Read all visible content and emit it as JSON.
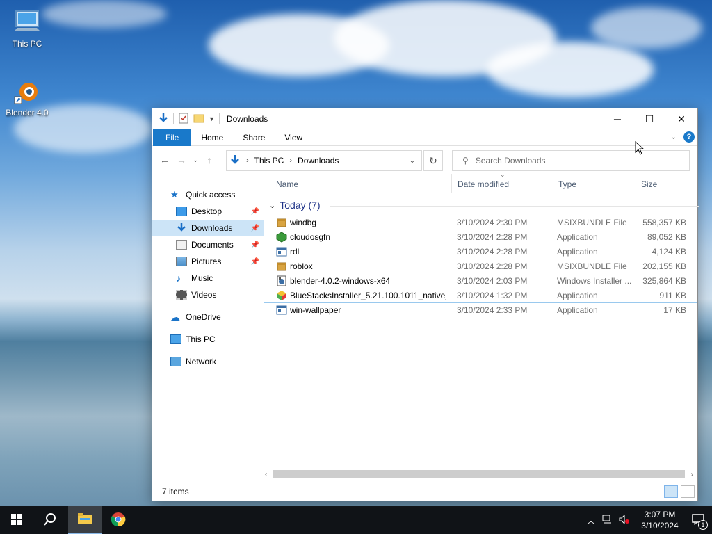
{
  "desktop": {
    "icons": [
      {
        "label": "This PC"
      },
      {
        "label": "Blender 4.0"
      }
    ]
  },
  "window": {
    "title": "Downloads",
    "ribbon_tabs": [
      "File",
      "Home",
      "Share",
      "View"
    ],
    "address": {
      "crumbs": [
        "This PC",
        "Downloads"
      ]
    },
    "search": {
      "placeholder": "Search Downloads"
    },
    "sidebar": {
      "items": [
        {
          "label": "Quick access",
          "icon": "star-icon"
        },
        {
          "label": "Desktop",
          "icon": "desktop-icon",
          "pinned": true
        },
        {
          "label": "Downloads",
          "icon": "download-icon",
          "pinned": true,
          "selected": true
        },
        {
          "label": "Documents",
          "icon": "documents-icon",
          "pinned": true
        },
        {
          "label": "Pictures",
          "icon": "pictures-icon",
          "pinned": true
        },
        {
          "label": "Music",
          "icon": "music-icon"
        },
        {
          "label": "Videos",
          "icon": "videos-icon"
        },
        {
          "label": "OneDrive",
          "icon": "cloud-icon"
        },
        {
          "label": "This PC",
          "icon": "computer-icon"
        },
        {
          "label": "Network",
          "icon": "network-icon"
        }
      ]
    },
    "columns": {
      "name": "Name",
      "date": "Date modified",
      "type": "Type",
      "size": "Size"
    },
    "group": {
      "label": "Today (7)"
    },
    "files": [
      {
        "name": "windbg",
        "date": "3/10/2024 2:30 PM",
        "type": "MSIXBUNDLE File",
        "size": "558,357 KB",
        "icon": "package-icon"
      },
      {
        "name": "cloudosgfn",
        "date": "3/10/2024 2:28 PM",
        "type": "Application",
        "size": "89,052 KB",
        "icon": "app-green-icon"
      },
      {
        "name": "rdl",
        "date": "3/10/2024 2:28 PM",
        "type": "Application",
        "size": "4,124 KB",
        "icon": "app-window-icon"
      },
      {
        "name": "roblox",
        "date": "3/10/2024 2:28 PM",
        "type": "MSIXBUNDLE File",
        "size": "202,155 KB",
        "icon": "package-icon"
      },
      {
        "name": "blender-4.0.2-windows-x64",
        "date": "3/10/2024 2:03 PM",
        "type": "Windows Installer ...",
        "size": "325,864 KB",
        "icon": "installer-icon"
      },
      {
        "name": "BlueStacksInstaller_5.21.100.1011_native_...",
        "date": "3/10/2024 1:32 PM",
        "type": "Application",
        "size": "911 KB",
        "icon": "bluestacks-icon"
      },
      {
        "name": "win-wallpaper",
        "date": "3/10/2024 2:33 PM",
        "type": "Application",
        "size": "17 KB",
        "icon": "app-window-icon"
      }
    ],
    "status": {
      "count": "7 items"
    }
  },
  "taskbar": {
    "time": "3:07 PM",
    "date": "3/10/2024",
    "notifications": "1"
  }
}
